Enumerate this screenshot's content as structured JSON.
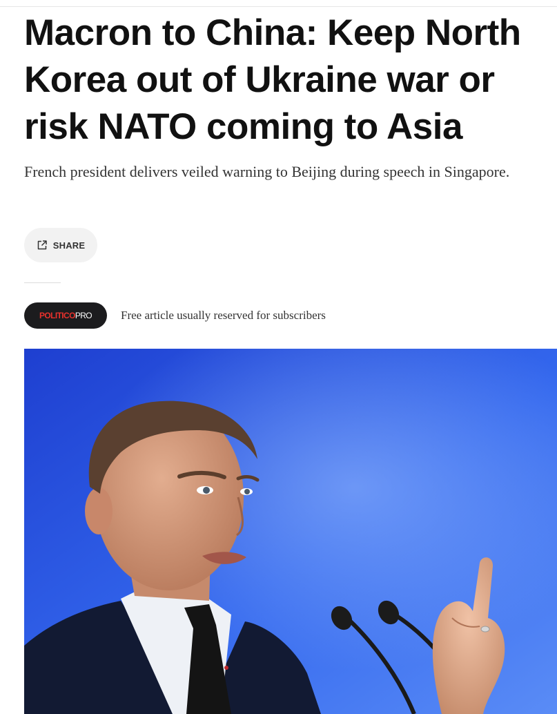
{
  "article": {
    "headline": "Macron to China: Keep North Korea out of Ukraine war or risk NATO coming to Asia",
    "dek": "French president delivers veiled warning to Beijing during speech in Singapore."
  },
  "share": {
    "label": "SHARE",
    "icon": "share-icon"
  },
  "pro": {
    "logo_part1": "POLITICO",
    "logo_part2": "PRO",
    "note": "Free article usually reserved for subscribers",
    "colors": {
      "badge_bg": "#1c1c1e",
      "logo_red": "#e8312c"
    }
  },
  "photo": {
    "subject": "speaker-at-podium-with-microphones",
    "background_color": "#2f5be0"
  }
}
